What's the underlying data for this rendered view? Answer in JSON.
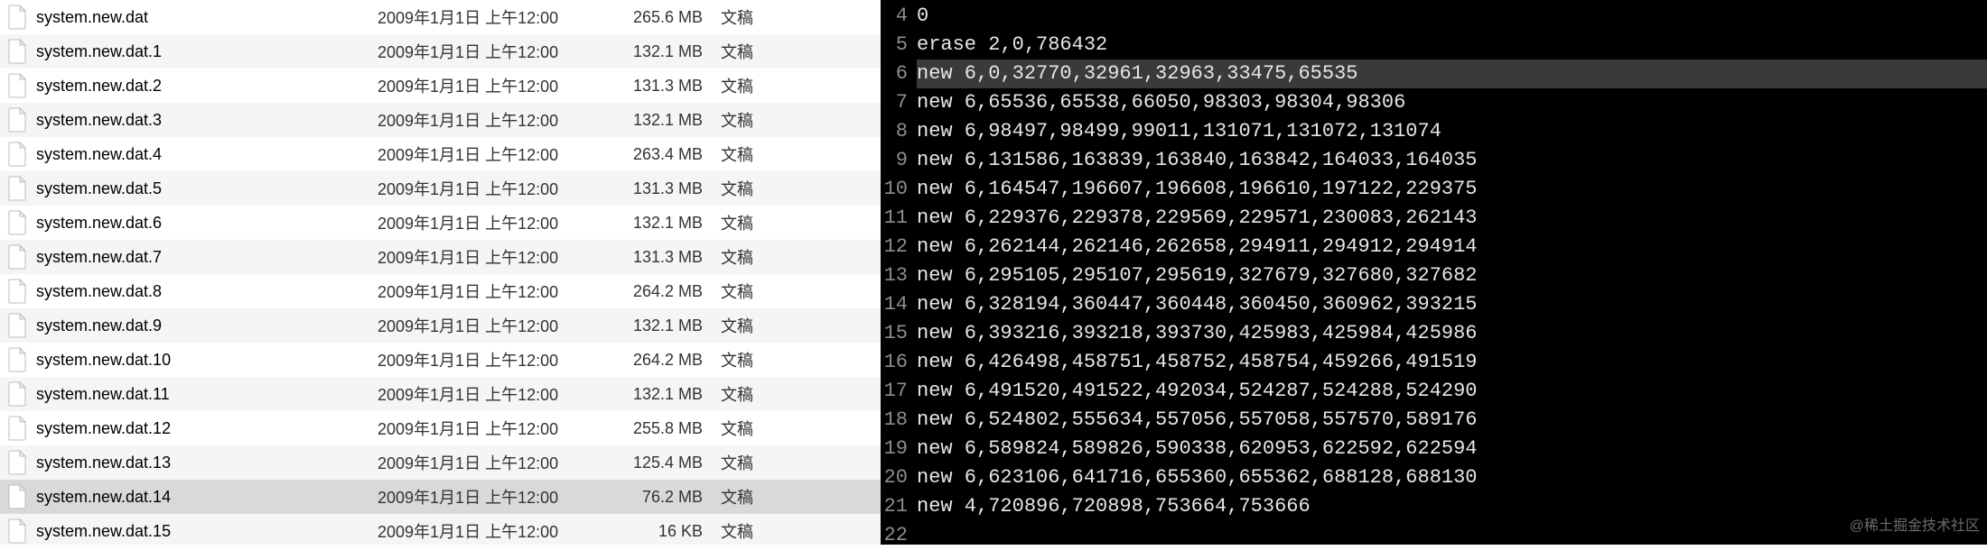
{
  "files": [
    {
      "name": "system.new.dat",
      "date": "2009年1月1日 上午12:00",
      "size": "265.6 MB",
      "kind": "文稿",
      "selected": false
    },
    {
      "name": "system.new.dat.1",
      "date": "2009年1月1日 上午12:00",
      "size": "132.1 MB",
      "kind": "文稿",
      "selected": false
    },
    {
      "name": "system.new.dat.2",
      "date": "2009年1月1日 上午12:00",
      "size": "131.3 MB",
      "kind": "文稿",
      "selected": false
    },
    {
      "name": "system.new.dat.3",
      "date": "2009年1月1日 上午12:00",
      "size": "132.1 MB",
      "kind": "文稿",
      "selected": false
    },
    {
      "name": "system.new.dat.4",
      "date": "2009年1月1日 上午12:00",
      "size": "263.4 MB",
      "kind": "文稿",
      "selected": false
    },
    {
      "name": "system.new.dat.5",
      "date": "2009年1月1日 上午12:00",
      "size": "131.3 MB",
      "kind": "文稿",
      "selected": false
    },
    {
      "name": "system.new.dat.6",
      "date": "2009年1月1日 上午12:00",
      "size": "132.1 MB",
      "kind": "文稿",
      "selected": false
    },
    {
      "name": "system.new.dat.7",
      "date": "2009年1月1日 上午12:00",
      "size": "131.3 MB",
      "kind": "文稿",
      "selected": false
    },
    {
      "name": "system.new.dat.8",
      "date": "2009年1月1日 上午12:00",
      "size": "264.2 MB",
      "kind": "文稿",
      "selected": false
    },
    {
      "name": "system.new.dat.9",
      "date": "2009年1月1日 上午12:00",
      "size": "132.1 MB",
      "kind": "文稿",
      "selected": false
    },
    {
      "name": "system.new.dat.10",
      "date": "2009年1月1日 上午12:00",
      "size": "264.2 MB",
      "kind": "文稿",
      "selected": false
    },
    {
      "name": "system.new.dat.11",
      "date": "2009年1月1日 上午12:00",
      "size": "132.1 MB",
      "kind": "文稿",
      "selected": false
    },
    {
      "name": "system.new.dat.12",
      "date": "2009年1月1日 上午12:00",
      "size": "255.8 MB",
      "kind": "文稿",
      "selected": false
    },
    {
      "name": "system.new.dat.13",
      "date": "2009年1月1日 上午12:00",
      "size": "125.4 MB",
      "kind": "文稿",
      "selected": false
    },
    {
      "name": "system.new.dat.14",
      "date": "2009年1月1日 上午12:00",
      "size": "76.2 MB",
      "kind": "文稿",
      "selected": true
    },
    {
      "name": "system.new.dat.15",
      "date": "2009年1月1日 上午12:00",
      "size": "16 KB",
      "kind": "文稿",
      "selected": false
    }
  ],
  "code": {
    "lines": [
      {
        "n": 4,
        "text": "0",
        "hl": false
      },
      {
        "n": 5,
        "text": "erase 2,0,786432",
        "hl": false
      },
      {
        "n": 6,
        "text": "new 6,0,32770,32961,32963,33475,65535",
        "hl": true
      },
      {
        "n": 7,
        "text": "new 6,65536,65538,66050,98303,98304,98306",
        "hl": false
      },
      {
        "n": 8,
        "text": "new 6,98497,98499,99011,131071,131072,131074",
        "hl": false
      },
      {
        "n": 9,
        "text": "new 6,131586,163839,163840,163842,164033,164035",
        "hl": false
      },
      {
        "n": 10,
        "text": "new 6,164547,196607,196608,196610,197122,229375",
        "hl": false
      },
      {
        "n": 11,
        "text": "new 6,229376,229378,229569,229571,230083,262143",
        "hl": false
      },
      {
        "n": 12,
        "text": "new 6,262144,262146,262658,294911,294912,294914",
        "hl": false
      },
      {
        "n": 13,
        "text": "new 6,295105,295107,295619,327679,327680,327682",
        "hl": false
      },
      {
        "n": 14,
        "text": "new 6,328194,360447,360448,360450,360962,393215",
        "hl": false
      },
      {
        "n": 15,
        "text": "new 6,393216,393218,393730,425983,425984,425986",
        "hl": false
      },
      {
        "n": 16,
        "text": "new 6,426498,458751,458752,458754,459266,491519",
        "hl": false
      },
      {
        "n": 17,
        "text": "new 6,491520,491522,492034,524287,524288,524290",
        "hl": false
      },
      {
        "n": 18,
        "text": "new 6,524802,555634,557056,557058,557570,589176",
        "hl": false
      },
      {
        "n": 19,
        "text": "new 6,589824,589826,590338,620953,622592,622594",
        "hl": false
      },
      {
        "n": 20,
        "text": "new 6,623106,641716,655360,655362,688128,688130",
        "hl": false
      },
      {
        "n": 21,
        "text": "new 4,720896,720898,753664,753666",
        "hl": false
      },
      {
        "n": 22,
        "text": "",
        "hl": false
      }
    ]
  },
  "watermark": "@稀土掘金技术社区"
}
